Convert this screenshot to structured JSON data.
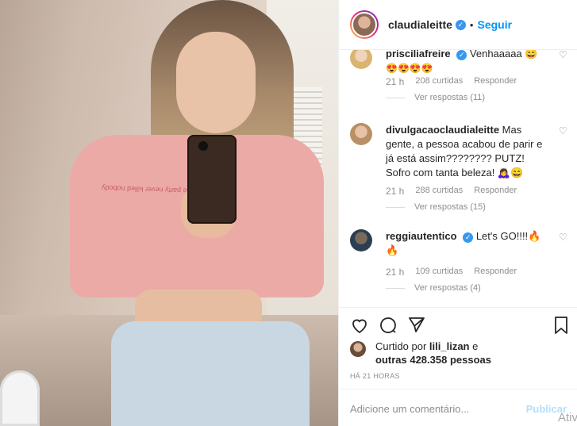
{
  "post": {
    "shirt_text": "a little party never killed nobody"
  },
  "header": {
    "username": "claudialeitte",
    "dot": "•",
    "follow_label": "Seguir"
  },
  "comments": [
    {
      "username": "prisciliafreire",
      "text": "Venhaaaaa 😄",
      "emojis": "😍😍😍😍",
      "time": "21 h",
      "likes": "208 curtidas",
      "reply": "Responder",
      "view_replies": "Ver respostas (11)"
    },
    {
      "username": "divulgacaoclaudialeitte",
      "text": "Mas gente, a pessoa acabou de parir e já está assim???????? PUTZ! Sofro com tanta beleza! 🙇‍♀️😄",
      "time": "21 h",
      "likes": "288 curtidas",
      "reply": "Responder",
      "view_replies": "Ver respostas (15)"
    },
    {
      "username": "reggiautentico",
      "text": "Let's GO!!!!🔥🔥",
      "time": "21 h",
      "likes": "109 curtidas",
      "reply": "Responder",
      "view_replies": "Ver respostas (4)"
    }
  ],
  "likes": {
    "prefix": "Curtido por ",
    "user": "lili_lizan",
    "middle": " e ",
    "others": "outras 428.358 pessoas"
  },
  "time_ago": "HÁ 21 HORAS",
  "add_comment": {
    "placeholder": "Adicione um comentário...",
    "publish": "Publicar"
  },
  "overlay": "Ativ",
  "icons": {
    "like": "heart-icon",
    "comment": "comment-icon",
    "share": "share-icon",
    "save": "bookmark-icon"
  }
}
